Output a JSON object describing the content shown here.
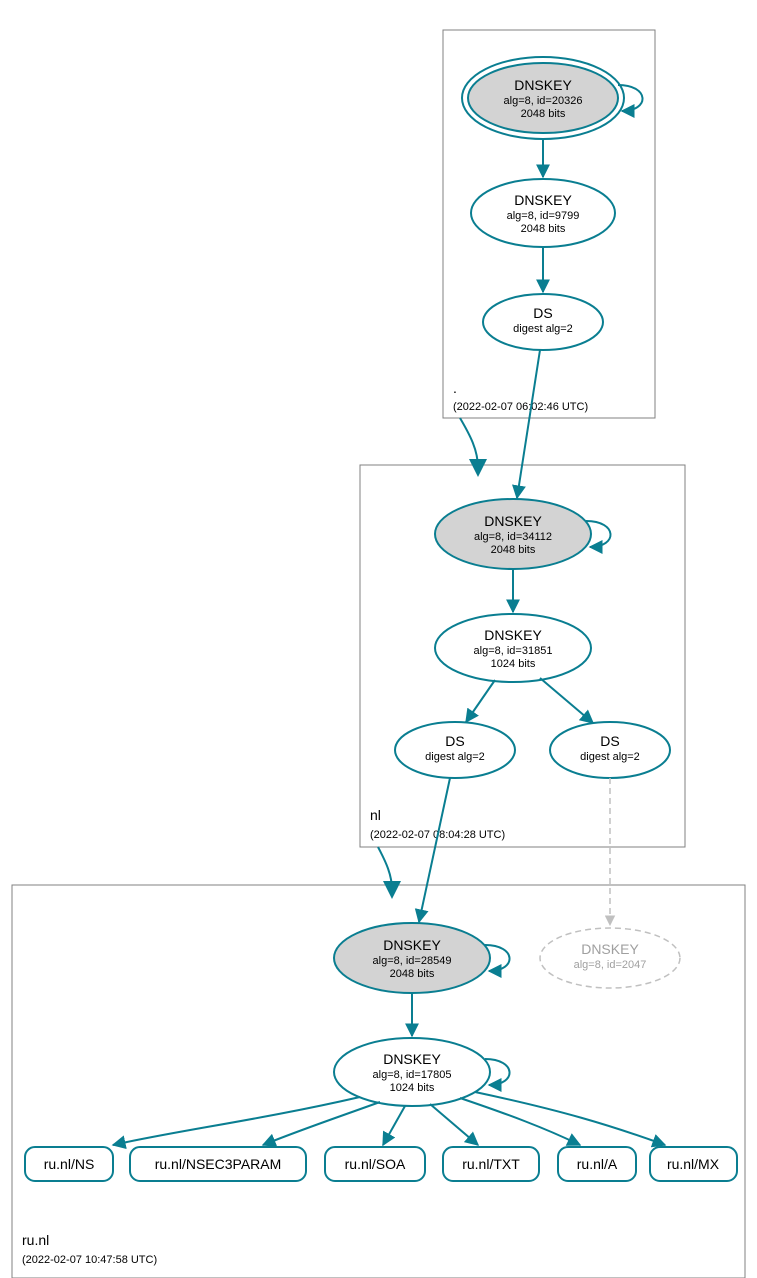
{
  "zones": {
    "root": {
      "label": ".",
      "timestamp": "(2022-02-07 06:02:46 UTC)"
    },
    "nl": {
      "label": "nl",
      "timestamp": "(2022-02-07 08:04:28 UTC)"
    },
    "runl": {
      "label": "ru.nl",
      "timestamp": "(2022-02-07 10:47:58 UTC)"
    }
  },
  "nodes": {
    "root_ksk": {
      "title": "DNSKEY",
      "line2": "alg=8, id=20326",
      "line3": "2048 bits"
    },
    "root_zsk": {
      "title": "DNSKEY",
      "line2": "alg=8, id=9799",
      "line3": "2048 bits"
    },
    "root_ds": {
      "title": "DS",
      "line2": "digest alg=2"
    },
    "nl_ksk": {
      "title": "DNSKEY",
      "line2": "alg=8, id=34112",
      "line3": "2048 bits"
    },
    "nl_zsk": {
      "title": "DNSKEY",
      "line2": "alg=8, id=31851",
      "line3": "1024 bits"
    },
    "nl_ds1": {
      "title": "DS",
      "line2": "digest alg=2"
    },
    "nl_ds2": {
      "title": "DS",
      "line2": "digest alg=2"
    },
    "runl_ksk": {
      "title": "DNSKEY",
      "line2": "alg=8, id=28549",
      "line3": "2048 bits"
    },
    "runl_zsk": {
      "title": "DNSKEY",
      "line2": "alg=8, id=17805",
      "line3": "1024 bits"
    },
    "runl_dashed": {
      "title": "DNSKEY",
      "line2": "alg=8, id=2047"
    },
    "rr_ns": {
      "label": "ru.nl/NS"
    },
    "rr_nsec3": {
      "label": "ru.nl/NSEC3PARAM"
    },
    "rr_soa": {
      "label": "ru.nl/SOA"
    },
    "rr_txt": {
      "label": "ru.nl/TXT"
    },
    "rr_a": {
      "label": "ru.nl/A"
    },
    "rr_mx": {
      "label": "ru.nl/MX"
    }
  }
}
